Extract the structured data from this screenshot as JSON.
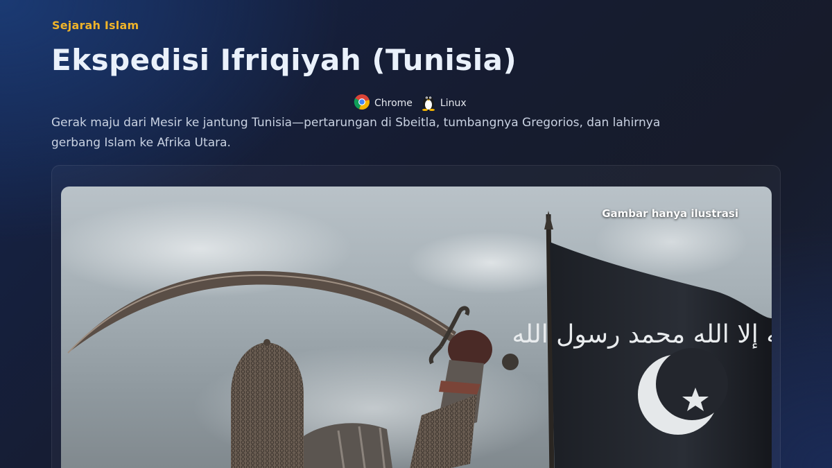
{
  "header": {
    "category": "Sejarah Islam",
    "title": "Ekspedisi Ifriqiyah (Tunisia)",
    "environment": [
      {
        "label": "Chrome",
        "icon": "chrome-icon"
      },
      {
        "label": "Linux",
        "icon": "linux-tux-icon"
      }
    ],
    "lead": "Gerak maju dari Mesir ke jantung Tunisia—pertarungan di Sbeitla, tumbangnya Gregorios, dan lahirnya gerbang Islam ke Afrika Utara."
  },
  "hero": {
    "caption": "Gambar hanya ilustrasi",
    "flag_text": "لا إله إلا الله محمد رسول الله"
  },
  "colors": {
    "accent": "#f0b429",
    "title": "#eaf1fb",
    "background": "#161c30"
  }
}
